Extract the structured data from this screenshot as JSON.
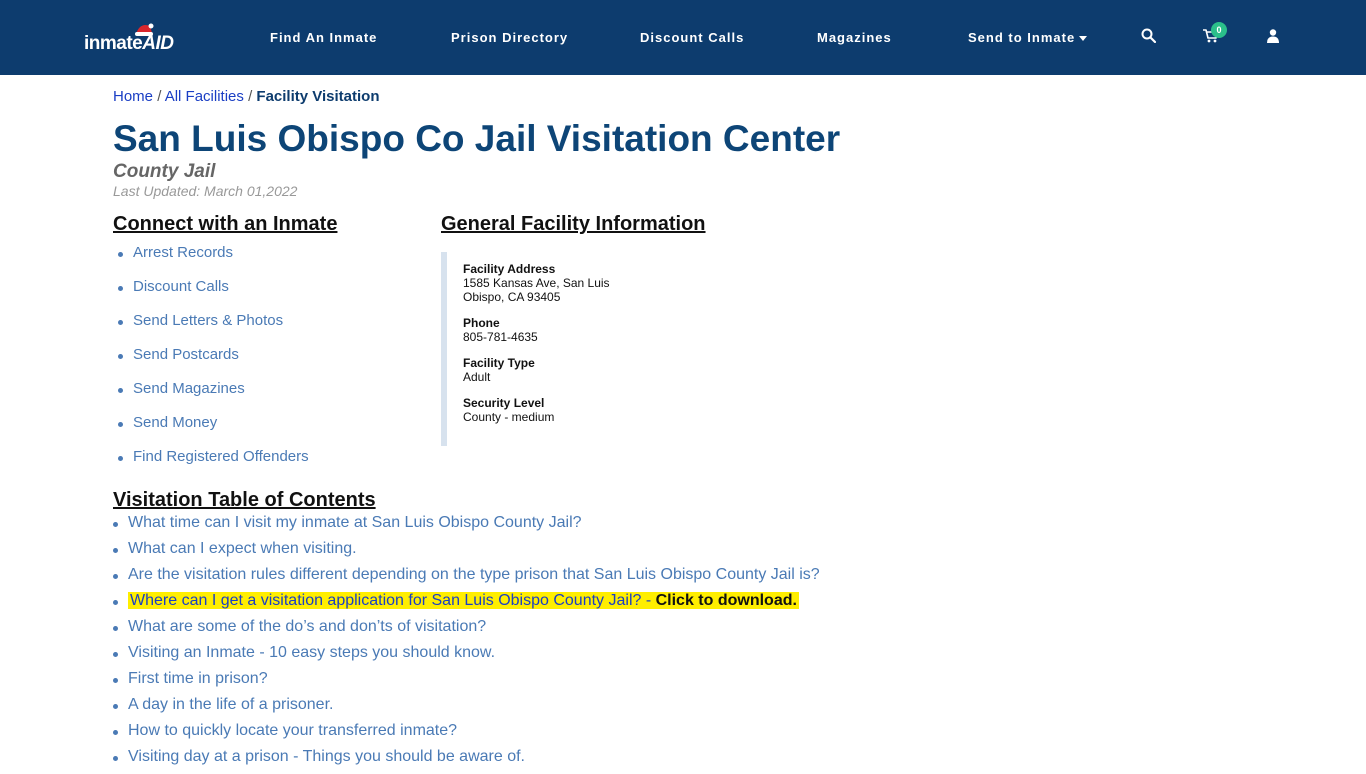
{
  "nav": {
    "logo_text_1": "inmate",
    "logo_text_2": "AID",
    "links": [
      "Find An Inmate",
      "Prison Directory",
      "Discount Calls",
      "Magazines",
      "Send to Inmate"
    ],
    "cart_count": "0",
    "icons": [
      "search-icon",
      "cart-icon",
      "user-icon"
    ],
    "colors": {
      "bar": "#0d3c6e",
      "badge": "#2bbf8a"
    }
  },
  "breadcrumb": {
    "home": "Home",
    "sep": "/",
    "facilities": "All Facilities",
    "current": "Facility Visitation"
  },
  "page": {
    "title": "San Luis Obispo Co Jail Visitation Center",
    "subtitle": "County Jail",
    "updated": "Last Updated: March 01,2022"
  },
  "connect": {
    "heading": "Connect with an Inmate",
    "items": [
      "Arrest Records",
      "Discount Calls",
      "Send Letters & Photos",
      "Send Postcards",
      "Send Magazines",
      "Send Money",
      "Find Registered Offenders"
    ]
  },
  "facility": {
    "heading": "General Facility Information",
    "address_label": "Facility Address",
    "address_value": "1585 Kansas Ave, San Luis Obispo, CA 93405",
    "phone_label": "Phone",
    "phone_value": "805-781-4635",
    "type_label": "Facility Type",
    "type_value": "Adult",
    "security_label": "Security Level",
    "security_value": "County - medium"
  },
  "toc": {
    "heading": "Visitation Table of Contents",
    "items": [
      "What time can I visit my inmate at San Luis Obispo County Jail?",
      "What can I expect when visiting.",
      "Are the visitation rules different depending on the type prison that San Luis Obispo County Jail is?",
      "Where can I get a visitation application for San Luis Obispo County Jail? - ",
      "What are some of the do’s and don’ts of visitation?",
      "Visiting an Inmate - 10 easy steps you should know.",
      "First time in prison?",
      "A day in the life of a prisoner.",
      "How to quickly locate your transferred inmate?",
      "Visiting day at a prison - Things you should be aware of."
    ],
    "download_label": "Click to download.",
    "highlight_color": "#ffee00"
  }
}
